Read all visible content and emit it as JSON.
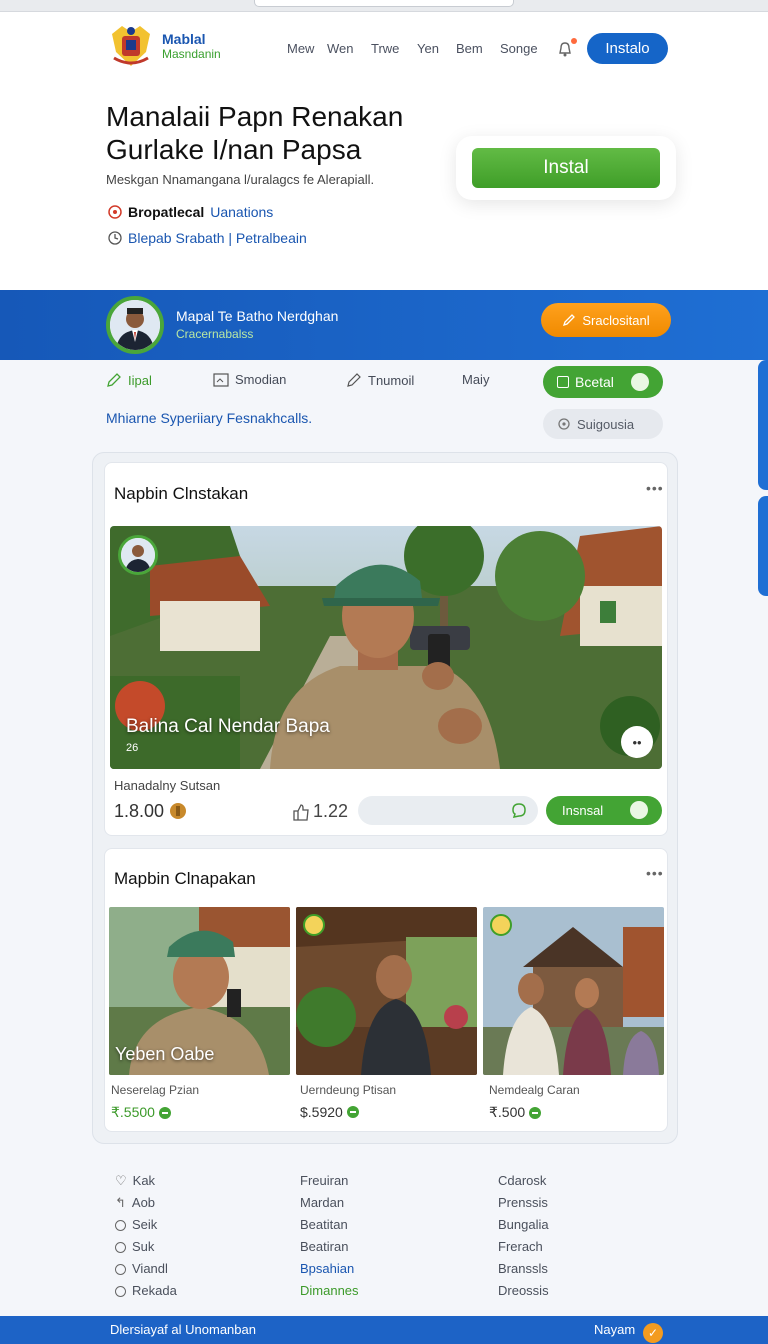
{
  "header": {
    "brand_line1": "Mablal",
    "brand_line2": "Masndanin",
    "nav": [
      "Mew",
      "Wen",
      "Trwe",
      "Yen",
      "Bem",
      "Songe"
    ],
    "install_label": "Instalo"
  },
  "hero": {
    "title_line1": "Manalaii Papn Renakan",
    "title_line2": "Gurlake I/nan Papsa",
    "subtitle": "Meskgan Nnamangana l/uralagcs fe Alerapiall.",
    "row1_bold": "Bropatlecal",
    "row1_link": "Uanations",
    "row2_text": "Blepab Srabath | Petralbeain",
    "install_label": "Instal"
  },
  "profile_band": {
    "title": "Mapal Te Batho Nerdghan",
    "subtitle": "Cracernabalss",
    "action_label": "Sraclositanl"
  },
  "tabs": {
    "items": [
      "Iipal",
      "Smodian",
      "Tnumoil",
      "Maiy"
    ],
    "active_pill": "Bcetal",
    "secondary_pill": "Suigousia",
    "link_line": "Mhiarne Syperiiary Fesnakhcalls."
  },
  "feed": {
    "card1": {
      "title": "Napbin Clnstakan",
      "photo_caption": "Balina Cal Nendar Bapa",
      "photo_small": "26",
      "meta_label": "Hanadalny Sutsan",
      "price": "1.8.00",
      "likes": "1.22",
      "install_label": "Insnsal"
    },
    "card2": {
      "title": "Mapbin Clnapakan",
      "tiles": [
        {
          "caption": "Yeben Oabe",
          "name": "Neserelag Pzian",
          "price": "₹.5500"
        },
        {
          "caption": "",
          "name": "Uerndeung Ptisan",
          "price": "$.5920"
        },
        {
          "caption": "",
          "name": "Nemdealg Caran",
          "price": "₹.500"
        }
      ]
    }
  },
  "footer": {
    "col1": [
      "Kak",
      "Aob",
      "Seik",
      "Suk",
      "Viandl",
      "Rekada"
    ],
    "col2": [
      "Freuiran",
      "Mardan",
      "Beatitan",
      "Beatiran",
      "Bpsahian",
      "Dimannes"
    ],
    "col3": [
      "Cdarosk",
      "Prenssis",
      "Bungalia",
      "Frerach",
      "Branssls",
      "Dreossis"
    ]
  },
  "bottom_bar": {
    "left_text": "Dlersiayaf al Unomanban",
    "right_text": "Nayam"
  },
  "colors": {
    "primary_blue": "#1565c8",
    "accent_green": "#43a434",
    "accent_orange": "#f39b1f"
  }
}
